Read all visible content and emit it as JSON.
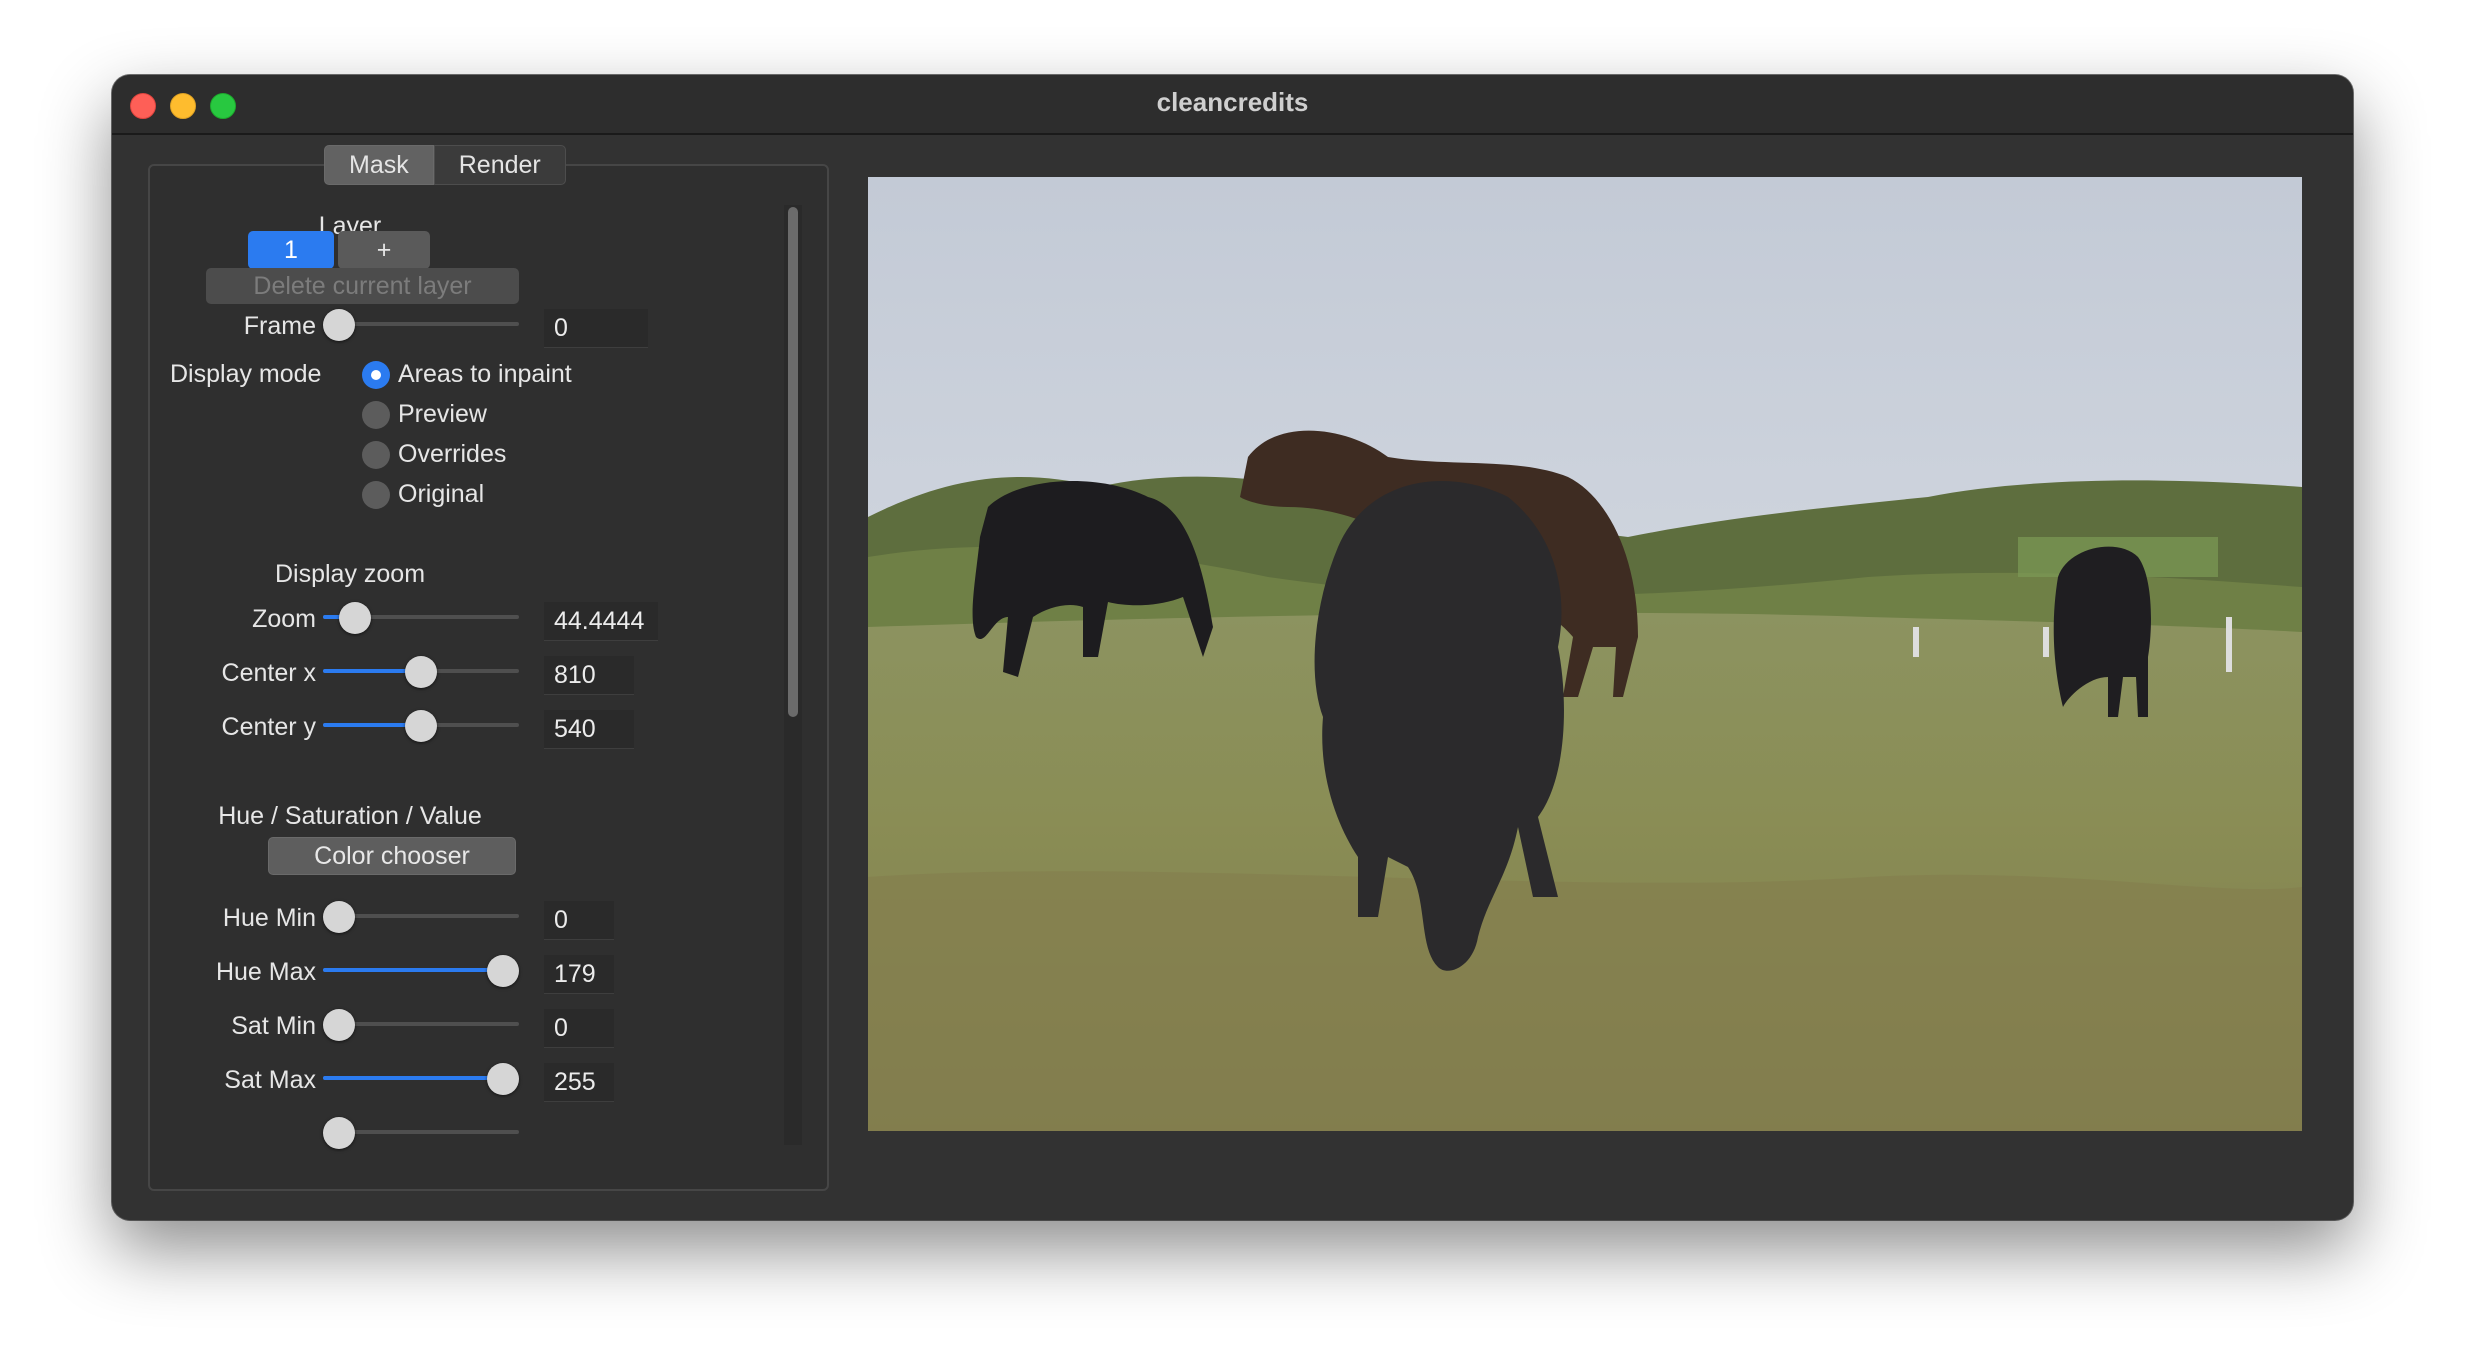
{
  "window": {
    "title": "cleancredits"
  },
  "tabs": [
    {
      "label": "Mask",
      "active": true
    },
    {
      "label": "Render",
      "active": false
    }
  ],
  "layer": {
    "title": "Layer",
    "current": "1",
    "add_label": "+",
    "delete_label": "Delete current layer"
  },
  "frame": {
    "label": "Frame",
    "value": "0",
    "slider_fraction": 0.0
  },
  "display_mode": {
    "label": "Display mode",
    "options": [
      {
        "label": "Areas to inpaint",
        "selected": true
      },
      {
        "label": "Preview",
        "selected": false
      },
      {
        "label": "Overrides",
        "selected": false
      },
      {
        "label": "Original",
        "selected": false
      }
    ]
  },
  "display_zoom": {
    "title": "Display zoom",
    "zoom": {
      "label": "Zoom",
      "value": "44.4444",
      "slider_fraction": 0.1
    },
    "center_x": {
      "label": "Center x",
      "value": "810",
      "slider_fraction": 0.5
    },
    "center_y": {
      "label": "Center y",
      "value": "540",
      "slider_fraction": 0.5
    }
  },
  "hsv": {
    "title": "Hue / Saturation / Value",
    "color_chooser_label": "Color chooser",
    "hue_min": {
      "label": "Hue Min",
      "value": "0",
      "slider_fraction": 0.0
    },
    "hue_max": {
      "label": "Hue Max",
      "value": "179",
      "slider_fraction": 1.0
    },
    "sat_min": {
      "label": "Sat Min",
      "value": "0",
      "slider_fraction": 0.0
    },
    "sat_max": {
      "label": "Sat Max",
      "value": "255",
      "slider_fraction": 1.0
    }
  },
  "colors": {
    "accent": "#2b7bf0",
    "window_bg": "#323232",
    "close": "#fe5f57",
    "minimize": "#febc2e",
    "maximize": "#28c840"
  }
}
